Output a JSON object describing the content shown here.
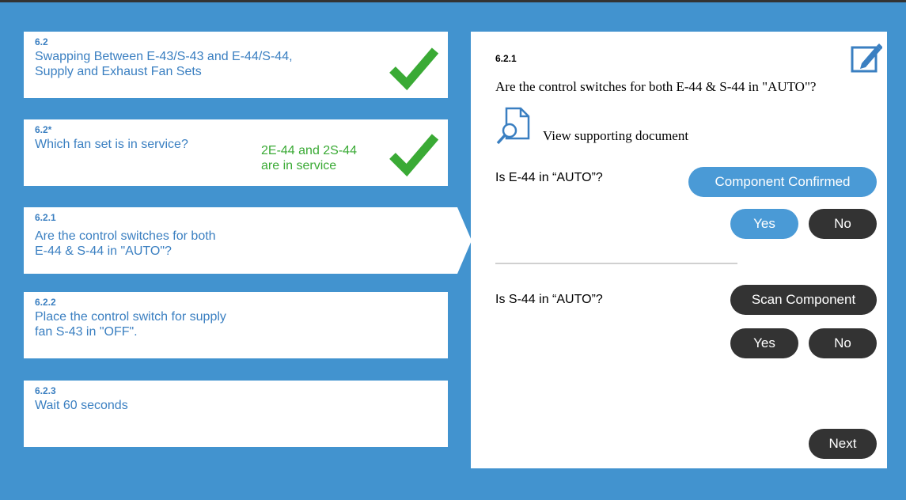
{
  "steps": [
    {
      "num": "6.2",
      "title_lines": [
        "Swapping Between E-43/S-43 and E-44/S-44,",
        "Supply and Exhaust Fan Sets"
      ]
    },
    {
      "num": "6.2*",
      "title_lines": [
        "Which fan set is in service?"
      ],
      "answer_lines": [
        "2E-44 and 2S-44",
        "are in service"
      ]
    },
    {
      "num": "6.2.1",
      "title_lines": [
        "Are the control switches for both",
        "E-44 & S-44 in \"AUTO\"?"
      ]
    },
    {
      "num": "6.2.2",
      "title_lines": [
        "Place the control switch for supply",
        "fan S-43 in \"OFF\"."
      ]
    },
    {
      "num": "6.2.3",
      "title_lines": [
        "Wait 60 seconds"
      ]
    }
  ],
  "panel": {
    "num": "6.2.1",
    "question": "Are the control switches for both E-44 & S-44 in \"AUTO\"?",
    "doc_link": "View supporting document",
    "q1": {
      "label": "Is E-44 in “AUTO”?",
      "component_btn": "Component Confirmed",
      "yes": "Yes",
      "no": "No"
    },
    "q2": {
      "label": "Is S-44 in “AUTO”?",
      "component_btn": "Scan Component",
      "yes": "Yes",
      "no": "No"
    },
    "next": "Next"
  },
  "colors": {
    "background": "#4293cf",
    "accent_blue": "#4a9ad6",
    "dark": "#333333",
    "check_green": "#3aaa35",
    "link_blue": "#3a7fc1"
  },
  "icons": [
    "checkmark-icon",
    "document-search-icon",
    "edit-icon"
  ]
}
